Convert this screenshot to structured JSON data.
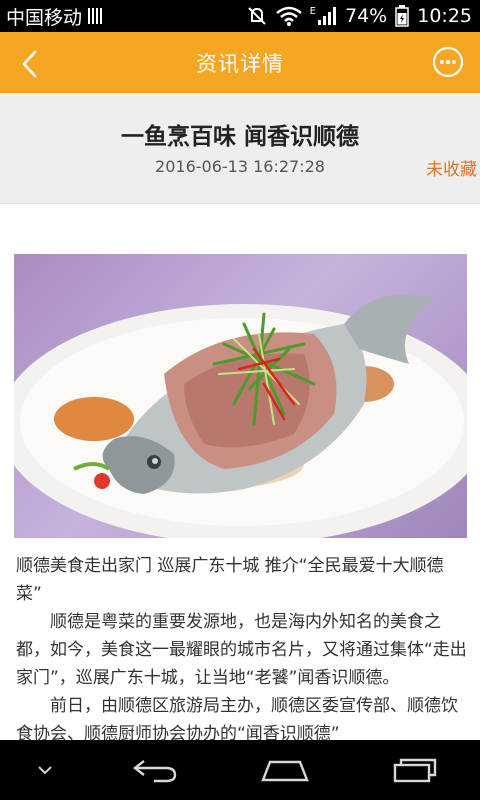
{
  "status_bar": {
    "carrier": "中国移动",
    "battery": "74%",
    "time": "10:25",
    "network_type": "E",
    "icons": [
      "sim-bars-icon",
      "mute-icon",
      "wifi-icon",
      "signal-icon",
      "battery-icon"
    ]
  },
  "header": {
    "title": "资讯详情",
    "back_icon": "chevron-left-icon",
    "more_icon": "more-circle-icon",
    "background": "#f5a623"
  },
  "article": {
    "title": "一鱼烹百味 闻香识顺德",
    "date": "2016-06-13 16:27:28",
    "favorite_label": "未收藏",
    "favorite_color": "#e0742a",
    "paragraphs": [
      "顺德美食走出家门 巡展广东十城 推介“全民最爱十大顺德菜”",
      "顺德是粤菜的重要发源地，也是海内外知名的美食之都，如今，美食这一最耀眼的城市名片，又将通过集体“走出家门”，巡展广东十城，让当地“老饕”闻香识顺德。",
      "前日，由顺德区旅游局主办，顺德区委宣传部、顺德饮食协会、顺德厨师协会协办的“闻香识顺德”"
    ]
  },
  "navbar": {
    "icons": [
      "chevron-down-icon",
      "back-arrow-icon",
      "home-icon",
      "recent-apps-icon"
    ]
  }
}
